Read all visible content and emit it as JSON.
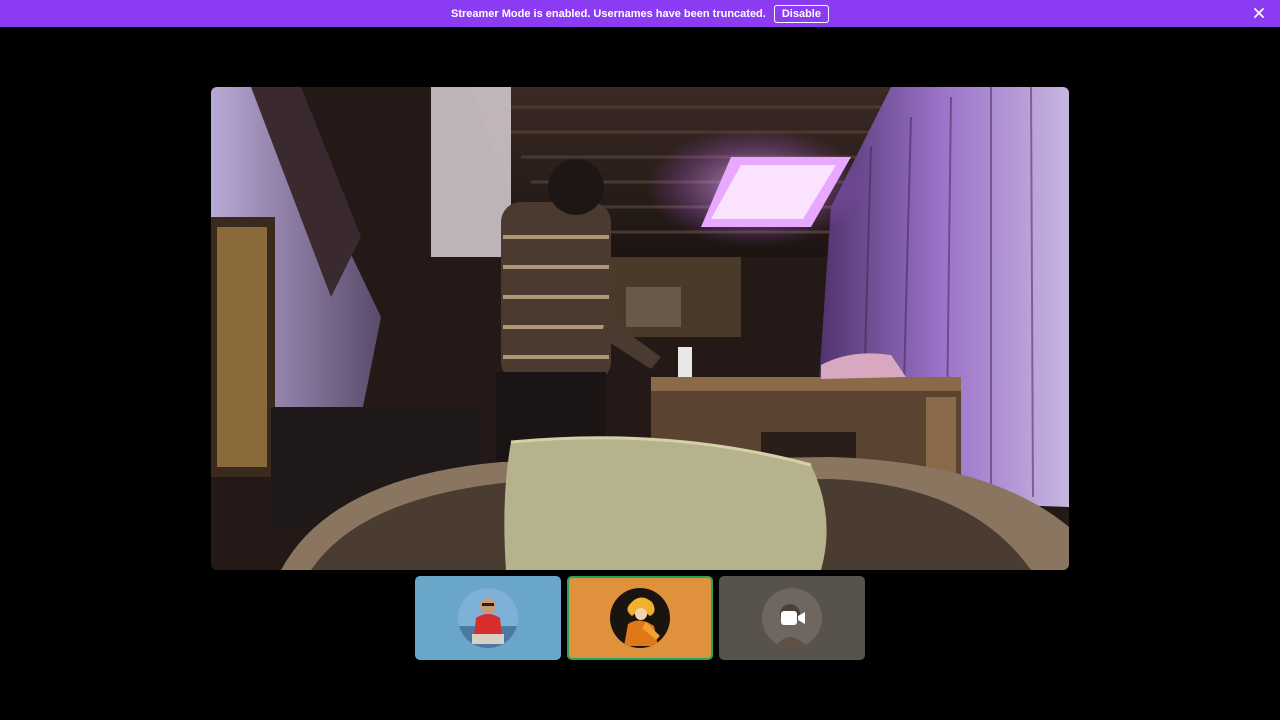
{
  "banner": {
    "message": "Streamer Mode is enabled. Usernames have been truncated.",
    "disable_label": "Disable",
    "background": "#8b3cf2"
  },
  "main_video": {
    "content": "webcam stream"
  },
  "participants": [
    {
      "tile_color": "#6aa6c8",
      "avatar": "avatar-person-red-shirt",
      "speaking": false
    },
    {
      "tile_color": "#e0913b",
      "avatar": "avatar-anime-character",
      "speaking": true
    },
    {
      "tile_color": "#58524c",
      "avatar": "video-camera-icon",
      "speaking": false
    }
  ],
  "colors": {
    "speaking_ring": "#23a55a"
  }
}
